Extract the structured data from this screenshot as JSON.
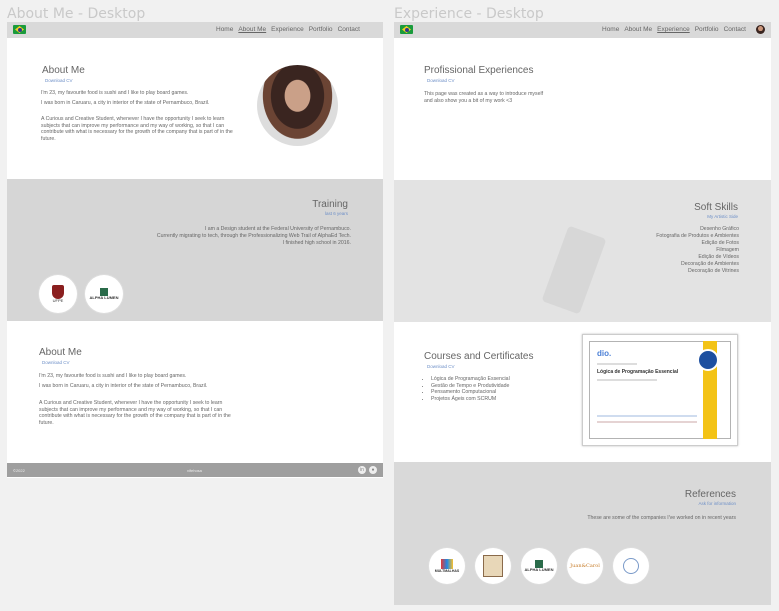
{
  "frame1": {
    "label": "About Me - Desktop",
    "nav": [
      "Home",
      "About Me",
      "Experience",
      "Portfolio",
      "Contact"
    ],
    "about": {
      "title": "About Me",
      "download": "Download CV",
      "p1": "I'm 23, my favourite food is sushi and I like to play board games.",
      "p2": "I was born in Caruaru, a city in interior of the state of Pernambuco, Brazil.",
      "p3": "A Curious and Creative Student, whenever I have the opportunity I seek to learn subjects that can improve my performance and my way of working, so that I can contribute with what is necessary for the growth of the company that is part of in the future."
    },
    "training": {
      "title": "Training",
      "sub": "last 6 years",
      "l1": "I am a Design student at the Federal University of Pernambuco.",
      "l2": "Currently migrating to tech, through the Professionalizing Web Trail of AlphaEd Tech.",
      "l3": "I finished high school in 2016.",
      "logo1": "UFPE",
      "logo2": "ALPHA LUMEN"
    },
    "about2": {
      "title": "About Me",
      "download": "Download CV",
      "p1": "I'm 23, my favourite food is sushi and I like to play board games.",
      "p2": "I was born in Caruaru, a city in interior of the state of Pernambuco, Brazil.",
      "p3": "A Curious and Creative Student, whenever I have the opportunity I seek to learn subjects that can improve my performance and my way of working, so that I can contribute with what is necessary for the growth of the company that is part of in the future."
    },
    "footer": {
      "left": "©2022",
      "center": "vifehosa",
      "icons": [
        "linkedin-icon",
        "github-icon"
      ]
    }
  },
  "frame2": {
    "label": "Experience - Desktop",
    "nav": [
      "Home",
      "About Me",
      "Experience",
      "Portfolio",
      "Contact"
    ],
    "prof": {
      "title": "Profissional Experiences",
      "download": "Download CV",
      "p1": "This page was created as a way to introduce myself",
      "p2": "and also show you a bit of my work <3"
    },
    "soft": {
      "title": "Soft Skills",
      "sub": "My Artistic Side",
      "items": [
        "Desenho Gráfico",
        "Fotografia de Produtos e Ambientes",
        "Edição de Fotos",
        "Filmagem",
        "Edição de Vídeos",
        "Decoração de Ambientes",
        "Decoração de Vitrines"
      ]
    },
    "courses": {
      "title": "Courses and Certificates",
      "download": "Download CV",
      "items": [
        "Lógica de Programação Essencial",
        "Gestão de Tempo e Produtividade",
        "Pensamento Computacional",
        "Projetos Ágeis com SCRUM"
      ],
      "cert_logo": "dio.",
      "cert_title": "Lógica de Programação Essencial"
    },
    "refs": {
      "title": "References",
      "sub": "Ask for information",
      "text": "These are some of the companies I've worked on in recent years",
      "logos": [
        "MULTMALHAS",
        "",
        "ALPHA LUMEN",
        "Juan&Carol",
        ""
      ]
    }
  }
}
